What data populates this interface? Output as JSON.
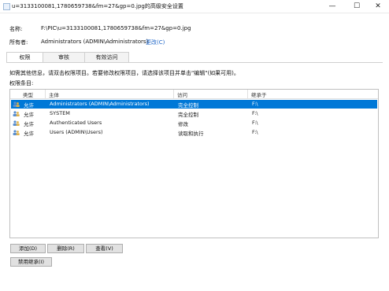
{
  "window": {
    "title": "u=3133100081,1780659738&fm=27&gp=0.jpg的高级安全设置"
  },
  "info": {
    "name_label": "名称:",
    "name_value": "F:\\PIC\\u=3133100081,1780659738&fm=27&gp=0.jpg",
    "owner_label": "所有者:",
    "owner_value": "Administrators (ADMIN\\Administrators)",
    "change_link": "更改(C)"
  },
  "tabs": [
    {
      "label": "权限",
      "active": true
    },
    {
      "label": "审核",
      "active": false
    },
    {
      "label": "有效访问",
      "active": false
    }
  ],
  "hint": "如需其他信息，请双击权限项目。若要修改权限项目，请选择该项目并单击\"编辑\"(如果可用)。",
  "entries_label": "权限条目:",
  "table": {
    "headers": [
      "类型",
      "主体",
      "访问",
      "继承于"
    ],
    "rows": [
      {
        "type": "允许",
        "principal": "Administrators (ADMIN\\Administrators)",
        "access": "完全控制",
        "inherited": "F:\\",
        "selected": true
      },
      {
        "type": "允许",
        "principal": "SYSTEM",
        "access": "完全控制",
        "inherited": "F:\\",
        "selected": false
      },
      {
        "type": "允许",
        "principal": "Authenticated Users",
        "access": "修改",
        "inherited": "F:\\",
        "selected": false
      },
      {
        "type": "允许",
        "principal": "Users (ADMIN\\Users)",
        "access": "读取和执行",
        "inherited": "F:\\",
        "selected": false
      }
    ]
  },
  "buttons": {
    "add": "添加(D)",
    "remove": "删除(R)",
    "view": "查看(V)",
    "disable_inheritance": "禁用继承(I)"
  },
  "colors": {
    "selection": "#0078d7",
    "link": "#1c64c7"
  }
}
